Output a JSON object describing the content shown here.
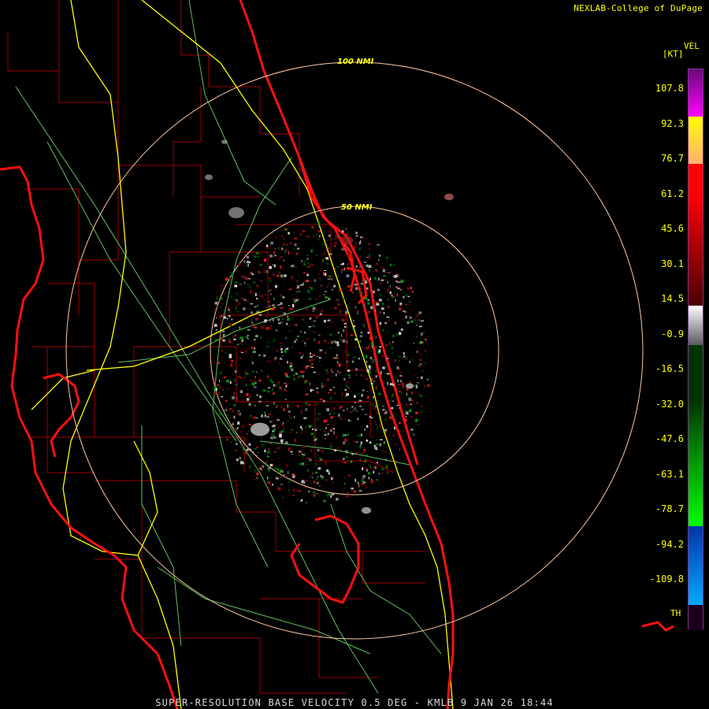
{
  "credit": "NEXLAB-College of DuPage",
  "footer": "SUPER-RESOLUTION BASE VELOCITY 0.5 DEG - KMLB 9 JAN 26 18:44",
  "legend": {
    "title": "VEL",
    "unit": "[KT]",
    "ticks": [
      "107.8",
      "92.3",
      "76.7",
      "61.2",
      "45.6",
      "30.1",
      "14.5",
      "-0.9",
      "-16.5",
      "-32.0",
      "-47.6",
      "-63.1",
      "-78.7",
      "-94.2",
      "-109.8"
    ],
    "bottom_label": "TH",
    "colors": [
      "#6a0a7a",
      "#ff00ff",
      "#ffff00",
      "#ffb070",
      "#ff0000",
      "#4a0000",
      "#ffffff",
      "#5a5a5a",
      "#003300",
      "#00ff00",
      "#0033aa",
      "#00aaff",
      "#1a001a"
    ]
  },
  "range_rings": {
    "inner_label": "50 NMI",
    "outer_label": "100 NMI",
    "color": "#ffc8a0"
  },
  "map_colors": {
    "coastline": "#ff0000",
    "counties": "#b00000",
    "highways": "#ffff00",
    "roads": "#66cc66"
  }
}
